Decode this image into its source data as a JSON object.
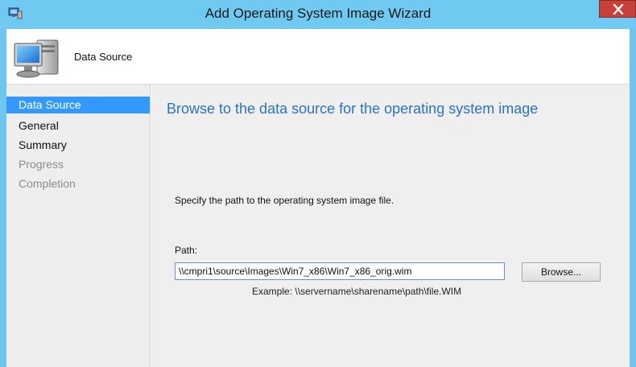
{
  "window": {
    "title": "Add Operating System Image Wizard"
  },
  "header": {
    "title": "Data Source"
  },
  "nav": {
    "items": [
      {
        "label": "Data Source"
      },
      {
        "label": "General"
      },
      {
        "label": "Summary"
      },
      {
        "label": "Progress"
      },
      {
        "label": "Completion"
      }
    ],
    "selected": "Data Source"
  },
  "main": {
    "heading": "Browse to the data source for the operating system image",
    "description": "Specify the path to the operating system image file.",
    "path_label": "Path:",
    "path_value": "\\\\cmpri1\\source\\Images\\Win7_x86\\Win7_x86_orig.wim",
    "browse_label": "Browse...",
    "example": "Example: \\\\servername\\sharename\\path\\file.WIM"
  },
  "colors": {
    "titlebar": "#6fc9f0",
    "selection": "#3399ff",
    "heading": "#2a73c5",
    "close": "#c7413a"
  },
  "icons": [
    "app-icon",
    "close-icon",
    "computer-icon"
  ]
}
